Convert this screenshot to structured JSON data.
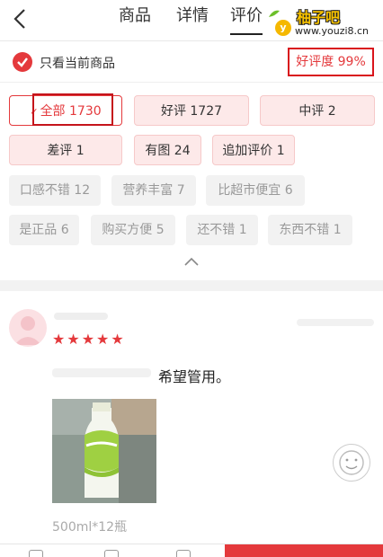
{
  "header": {
    "tabs": [
      {
        "label": "商品"
      },
      {
        "label": "详情"
      },
      {
        "label": "评价"
      }
    ],
    "watermark": {
      "badge": "y",
      "logo": "柚子吧",
      "url": "www.youzi8.cn"
    }
  },
  "filter": {
    "only_current_label": "只看当前商品",
    "positive_rate": "好评度 99%"
  },
  "tags": {
    "all": "全部 1730",
    "all_check": "✓",
    "good": "好评 1727",
    "medium": "中评 2",
    "bad": "差评 1",
    "with_pic": "有图 24",
    "followup": "追加评价 1",
    "taste": "口感不错 12",
    "nutrition": "营养丰富 7",
    "cheaper": "比超市便宜 6",
    "genuine": "是正品 6",
    "convenient": "购买方便 5",
    "not_bad": "还不错 1",
    "good_stuff": "东西不错 1"
  },
  "review": {
    "stars": "★★★★★",
    "text": "希望管用。",
    "spec": "500ml*12瓶"
  },
  "colors": {
    "accent": "#e4393c",
    "highlight_frame": "#c5141b"
  }
}
